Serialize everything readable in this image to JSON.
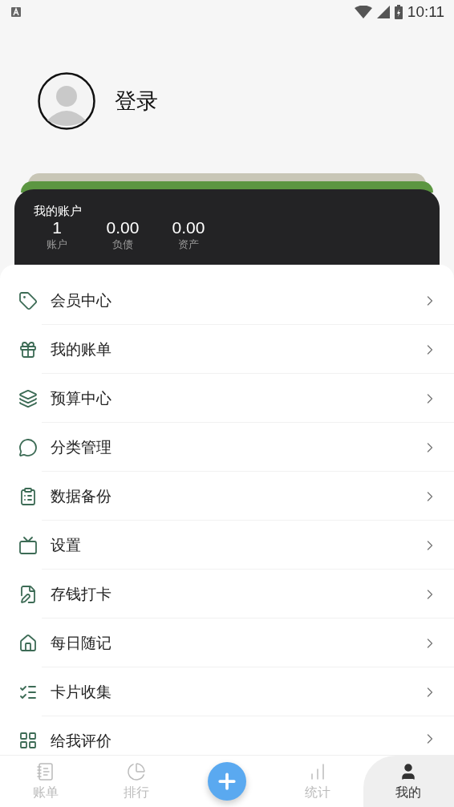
{
  "status_bar": {
    "time": "10:11"
  },
  "profile": {
    "login": "登录"
  },
  "account_card": {
    "title": "我的账户",
    "stats": [
      {
        "value": "1",
        "label": "账户"
      },
      {
        "value": "0.00",
        "label": "负债"
      },
      {
        "value": "0.00",
        "label": "资产"
      }
    ]
  },
  "menu": [
    {
      "label": "会员中心"
    },
    {
      "label": "我的账单"
    },
    {
      "label": "预算中心"
    },
    {
      "label": "分类管理"
    },
    {
      "label": "数据备份"
    },
    {
      "label": "设置"
    },
    {
      "label": "存钱打卡"
    },
    {
      "label": "每日随记"
    },
    {
      "label": "卡片收集"
    },
    {
      "label": "给我评价"
    }
  ],
  "bottom_nav": [
    {
      "label": "账单",
      "kind": "tab",
      "selected": false
    },
    {
      "label": "排行",
      "kind": "tab",
      "selected": false
    },
    {
      "kind": "add"
    },
    {
      "label": "统计",
      "kind": "tab",
      "selected": false
    },
    {
      "label": "我的",
      "kind": "tab",
      "selected": true
    }
  ]
}
